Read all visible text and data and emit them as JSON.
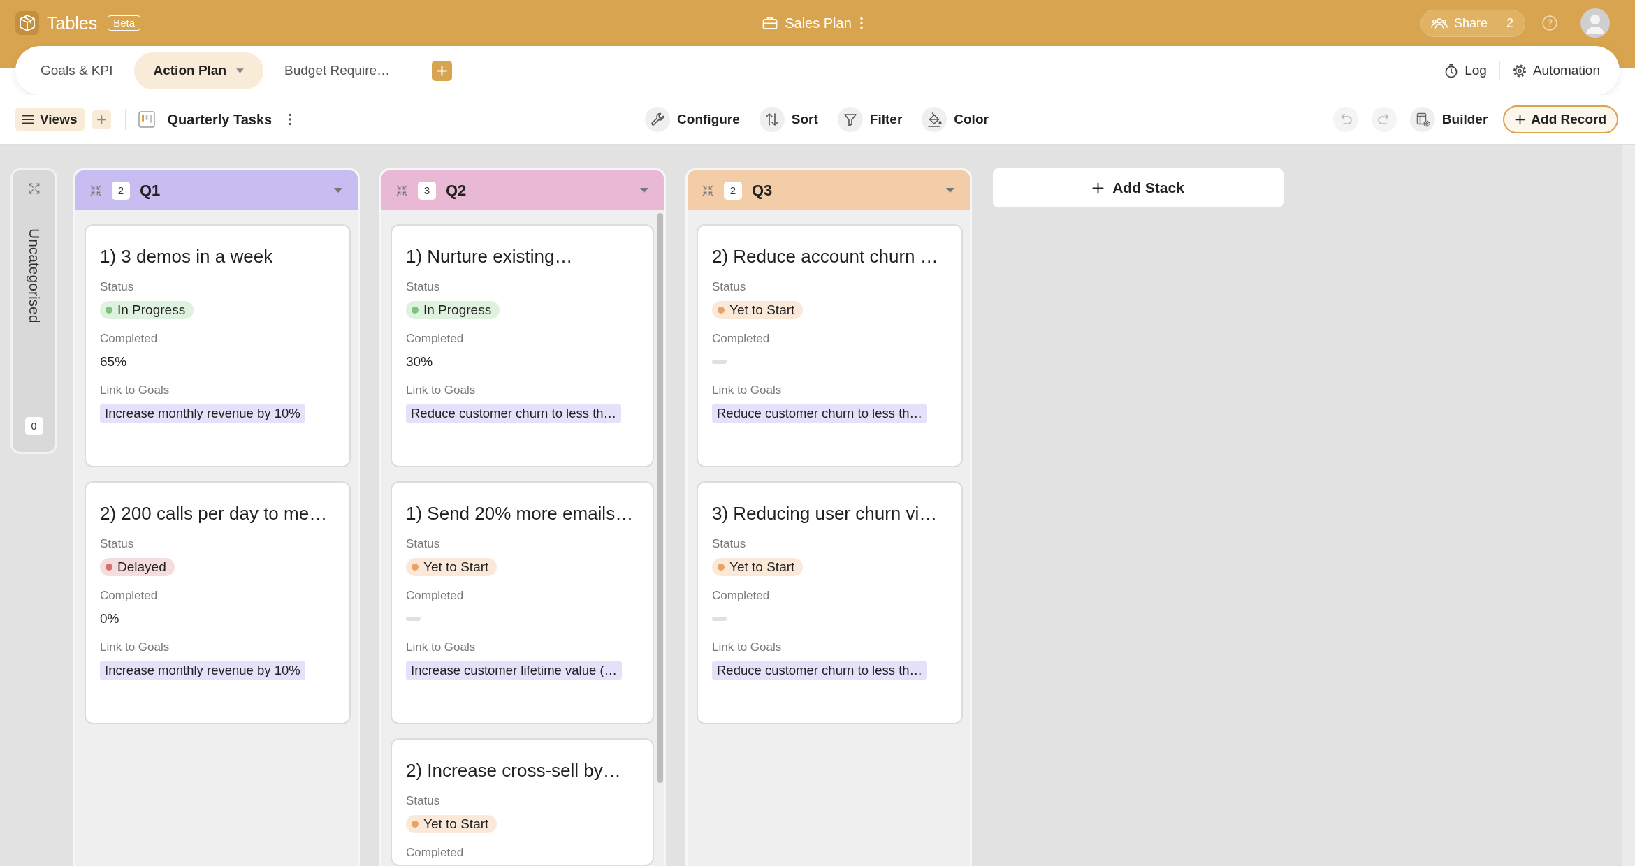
{
  "header": {
    "app_name": "Tables",
    "badge": "Beta",
    "document_title": "Sales Plan",
    "share_label": "Share",
    "share_count": "2"
  },
  "tabs": [
    {
      "label": "Goals & KPI",
      "selected": false
    },
    {
      "label": "Action Plan",
      "selected": true
    },
    {
      "label": "Budget Require…",
      "selected": false
    }
  ],
  "tab_bar_actions": [
    {
      "kind": "log",
      "label": "Log"
    },
    {
      "kind": "automation",
      "label": "Automation"
    }
  ],
  "toolbar": {
    "views_label": "Views",
    "view_name": "Quarterly Tasks",
    "tools": [
      {
        "kind": "configure",
        "label": "Configure"
      },
      {
        "kind": "sort",
        "label": "Sort"
      },
      {
        "kind": "filter",
        "label": "Filter"
      },
      {
        "kind": "color",
        "label": "Color"
      }
    ],
    "history": [
      {
        "kind": "undo",
        "disabled": true
      },
      {
        "kind": "redo",
        "disabled": true
      }
    ],
    "builder_label": "Builder",
    "add_record_label": "Add Record"
  },
  "board": {
    "uncategorised": {
      "label": "Uncategorised",
      "count": "0"
    },
    "stacks": [
      {
        "title": "Q1",
        "count": "2",
        "color": "#c8bdf0",
        "cards": [
          {
            "title": "1) 3 demos in a week",
            "fields": [
              {
                "kind": "status",
                "label": "Status",
                "value": "In Progress",
                "color": "#7bc47a"
              },
              {
                "kind": "number",
                "label": "Completed",
                "value": "65%"
              },
              {
                "kind": "link",
                "label": "Link to Goals",
                "value": "Increase monthly revenue by 10%"
              }
            ]
          },
          {
            "title": "2) 200 calls per day to me…",
            "fields": [
              {
                "kind": "status",
                "label": "Status",
                "value": "Delayed",
                "color": "#d77171"
              },
              {
                "kind": "number",
                "label": "Completed",
                "value": "0%"
              },
              {
                "kind": "link",
                "label": "Link to Goals",
                "value": "Increase monthly revenue by 10%"
              }
            ]
          }
        ]
      },
      {
        "title": "Q2",
        "count": "3",
        "color": "#e8b8d5",
        "cards": [
          {
            "title": "1) Nurture existing…",
            "fields": [
              {
                "kind": "status",
                "label": "Status",
                "value": "In Progress",
                "color": "#7bc47a"
              },
              {
                "kind": "number",
                "label": "Completed",
                "value": "30%"
              },
              {
                "kind": "link",
                "label": "Link to Goals",
                "value": "Reduce customer churn to less th…"
              }
            ]
          },
          {
            "title": "1) Send 20% more emails…",
            "fields": [
              {
                "kind": "status",
                "label": "Status",
                "value": "Yet to Start",
                "color": "#eba262"
              },
              {
                "kind": "number",
                "label": "Completed",
                "empty": true
              },
              {
                "kind": "link",
                "label": "Link to Goals",
                "value": "Increase customer lifetime value (…"
              }
            ]
          },
          {
            "title": "2) Increase cross-sell by…",
            "fields": [
              {
                "kind": "status",
                "label": "Status",
                "value": "Yet to Start",
                "color": "#eba262"
              },
              {
                "kind": "number",
                "label": "Completed"
              }
            ]
          }
        ]
      },
      {
        "title": "Q3",
        "count": "2",
        "color": "#f2cda8",
        "cards": [
          {
            "title": "2) Reduce account churn …",
            "fields": [
              {
                "kind": "status",
                "label": "Status",
                "value": "Yet to Start",
                "color": "#eba262"
              },
              {
                "kind": "number",
                "label": "Completed",
                "empty": true
              },
              {
                "kind": "link",
                "label": "Link to Goals",
                "value": "Reduce customer churn to less th…"
              }
            ]
          },
          {
            "title": "3) Reducing user churn vi…",
            "fields": [
              {
                "kind": "status",
                "label": "Status",
                "value": "Yet to Start",
                "color": "#eba262"
              },
              {
                "kind": "number",
                "label": "Completed",
                "empty": true
              },
              {
                "kind": "link",
                "label": "Link to Goals",
                "value": "Reduce customer churn to less th…"
              }
            ]
          }
        ]
      }
    ],
    "add_stack_label": "Add Stack"
  }
}
